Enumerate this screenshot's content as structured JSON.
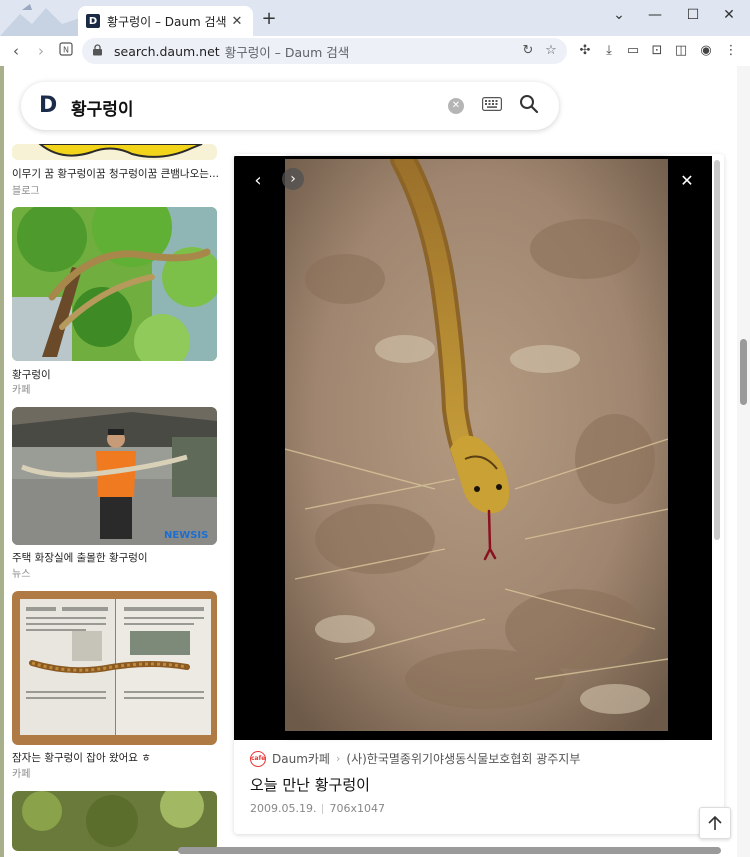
{
  "browser": {
    "tab_title": "황구렁이 – Daum 검색",
    "favicon_letter": "D",
    "tab_close": "✕",
    "new_tab": "+",
    "url_domain": "search.daum.net",
    "url_rest": "황구렁이 – Daum 검색",
    "window_controls": {
      "minimize": "—",
      "maximize": "☐",
      "close": "✕",
      "menu": "⌄"
    }
  },
  "search": {
    "logo": "D",
    "query": "황구렁이",
    "clear": "✕"
  },
  "results": [
    {
      "caption": "이무기 꿈 황구렁이꿈 청구렁이꿈 큰뱀나오는...",
      "source": "블로그"
    },
    {
      "caption": "황구렁이",
      "source": "카페"
    },
    {
      "caption": "주택 화장실에 출몰한 황구렁이",
      "source": "뉴스",
      "watermark": "NEWSIS"
    },
    {
      "caption": "잠자는 황구렁이 잡아 왔어요 ㅎ",
      "source": "카페"
    }
  ],
  "viewer": {
    "source_name": "Daum카페",
    "source_icon_text": "cafe",
    "source_separator": "›",
    "cafe_name": "(사)한국멸종위기야생동식물보호협회 광주지부",
    "title": "오늘 만난 황구렁이",
    "date": "2009.05.19.",
    "size": "706x1047"
  },
  "icons": {
    "back": "search-back-icon",
    "forward": "forward-icon",
    "reload": "reload-icon",
    "keyboard": "keyboard-icon",
    "search": "search-icon",
    "top": "scroll-top-icon"
  }
}
